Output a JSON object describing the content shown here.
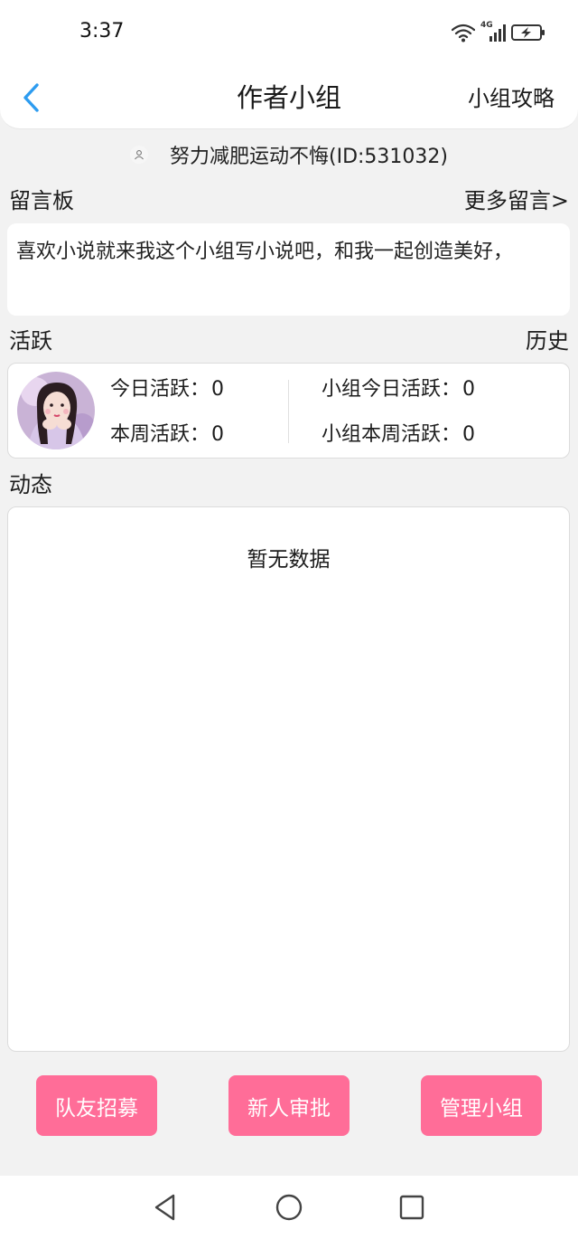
{
  "status_bar": {
    "time": "3:37",
    "network": "4G",
    "icons": [
      "wifi-icon",
      "cellular-signal-icon",
      "battery-charging-icon"
    ]
  },
  "header": {
    "back_icon": "chevron-left-icon",
    "title": "作者小组",
    "guide_link": "小组攻略"
  },
  "group": {
    "icon": "user-icon",
    "name": "努力减肥运动不悔(ID:531032)"
  },
  "message_board": {
    "label": "留言板",
    "more_link": "更多留言>",
    "message": "喜欢小说就来我这个小组写小说吧，和我一起创造美好，"
  },
  "activity": {
    "label": "活跃",
    "history_link": "历史",
    "today_label": "今日活跃：",
    "today_value": "0",
    "week_label": "本周活跃：",
    "week_value": "0",
    "group_today_label": "小组今日活跃：",
    "group_today_value": "0",
    "group_week_label": "小组本周活跃：",
    "group_week_value": "0"
  },
  "feed": {
    "label": "动态",
    "empty_text": "暂无数据"
  },
  "actions": {
    "recruit": "队友招募",
    "approve": "新人审批",
    "manage": "管理小组"
  },
  "colors": {
    "accent_blue": "#2d9cf0",
    "button_pink": "#ff6d98",
    "background": "#f2f2f2"
  }
}
